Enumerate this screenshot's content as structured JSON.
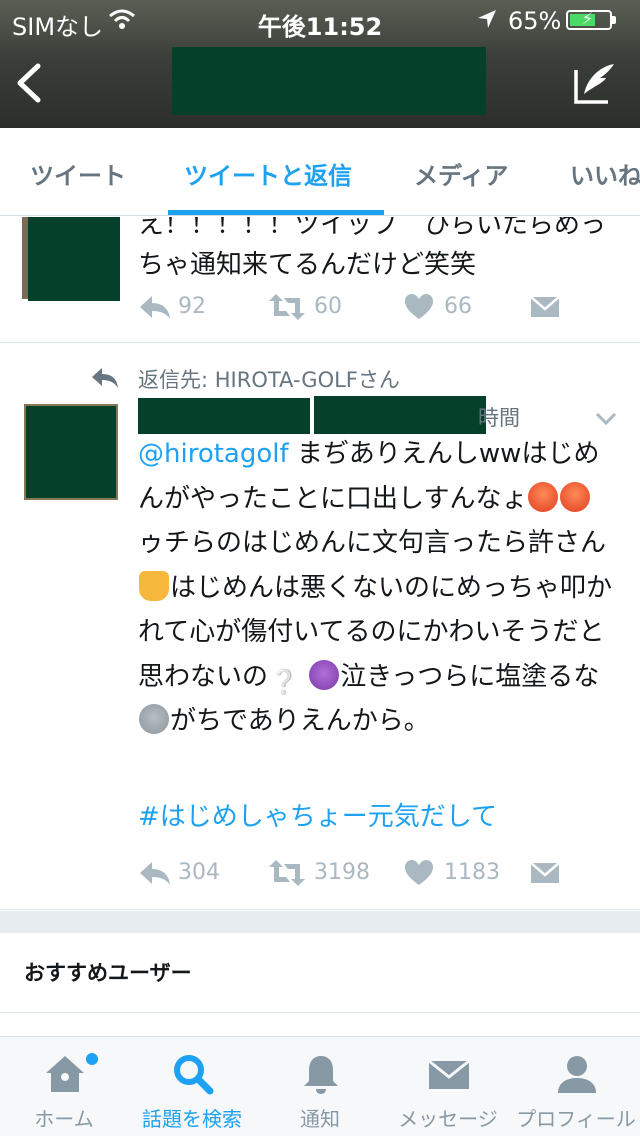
{
  "status_bar": {
    "carrier": "SIMなし",
    "time": "午後11:52",
    "battery": "65%",
    "battery_level": 0.65
  },
  "tabs": [
    {
      "label": "ツイート",
      "active": false
    },
    {
      "label": "ツイートと返信",
      "active": true
    },
    {
      "label": "メディア",
      "active": false
    },
    {
      "label": "いいね",
      "active": false
    }
  ],
  "tweet_1": {
    "text_line_1": "え！！！！！ツイップ　ひらいたらめっ",
    "text_line_2": "ちゃ通知来てるんだけど笑笑",
    "replies": "92",
    "retweets": "60",
    "likes": "66"
  },
  "tweet_2": {
    "reply_context": "返信先: HIROTA-GOLFさん",
    "time": "時間",
    "mention": "@hirotagolf",
    "text_1": " まぢありえんしwwはじめんがやったことに口出しすんなょ",
    "text_2": "ゥチらのはじめんに文句言ったら許さん",
    "text_3": "はじめんは悪くないのにめっちゃ叩かれて心が傷付いてるのにかわいそうだと思わないの",
    "text_4": "泣きっつらに塩塗るな",
    "text_5": "がちでありえんから。",
    "question_mark": "❔",
    "hashtag": "#はじめしゃちょー元気だして",
    "replies": "304",
    "retweets": "3198",
    "likes": "1183"
  },
  "recommended": {
    "title": "おすすめユーザー"
  },
  "tabbar": [
    {
      "label": "ホーム",
      "icon": "home-icon",
      "active": false
    },
    {
      "label": "話題を検索",
      "icon": "search-icon",
      "active": true
    },
    {
      "label": "通知",
      "icon": "bell-icon",
      "active": false
    },
    {
      "label": "メッセージ",
      "icon": "envelope-icon",
      "active": false
    },
    {
      "label": "プロフィール",
      "icon": "profile-icon",
      "active": false
    }
  ],
  "colors": {
    "accent": "#1da1f2",
    "text": "#14171a",
    "muted": "#aab8c2",
    "redacted": "#05402b"
  }
}
